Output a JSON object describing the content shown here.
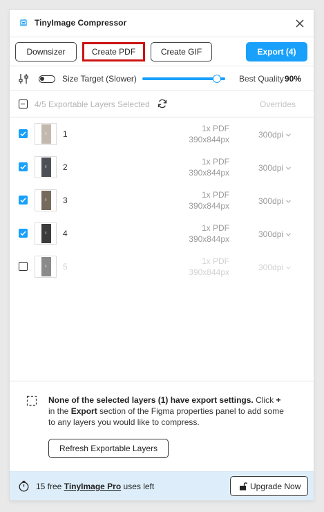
{
  "app": {
    "title": "TinyImage Compressor",
    "logo_icon": "tinyimage-logo-icon",
    "close_icon": "close-icon"
  },
  "toolbar": {
    "downsizer": "Downsizer",
    "create_pdf": "Create PDF",
    "create_gif": "Create GIF",
    "export": "Export (4)",
    "accent_color": "#18a0fb",
    "highlight_color": "#cc1111"
  },
  "size_target": {
    "label": "Size Target (Slower)",
    "toggle_on": false,
    "quality_label": "Best Quality",
    "quality_value": "90%",
    "quality_fraction": 0.9
  },
  "selection": {
    "summary": "4/5 Exportable Layers Selected",
    "overrides": "Overrides"
  },
  "layers": [
    {
      "name": "1",
      "format": "1x PDF",
      "size": "390x844px",
      "dpi": "300dpi",
      "checked": true,
      "thumb_color": "#c3b8ad"
    },
    {
      "name": "2",
      "format": "1x PDF",
      "size": "390x844px",
      "dpi": "300dpi",
      "checked": true,
      "thumb_color": "#4d5157"
    },
    {
      "name": "3",
      "format": "1x PDF",
      "size": "390x844px",
      "dpi": "300dpi",
      "checked": true,
      "thumb_color": "#76695d"
    },
    {
      "name": "4",
      "format": "1x PDF",
      "size": "390x844px",
      "dpi": "300dpi",
      "checked": true,
      "thumb_color": "#3b3b3b"
    },
    {
      "name": "5",
      "format": "1x PDF",
      "size": "390x844px",
      "dpi": "300dpi",
      "checked": false,
      "thumb_color": "#8a8a8a"
    }
  ],
  "notice": {
    "text_part1": "None of the selected layers (1) have export settings.",
    "text_part2": " Click ",
    "plus": "+",
    "text_part3": " in the ",
    "export_word": "Export",
    "text_part4": " section of the Figma properties panel to add some to any layers you would like to compress.",
    "refresh_button": "Refresh Exportable Layers"
  },
  "footer": {
    "prefix": "15 free ",
    "pro_link": "TinyImage Pro",
    "suffix": " uses left",
    "upgrade_button": "Upgrade Now",
    "background": "#ddeefa"
  }
}
